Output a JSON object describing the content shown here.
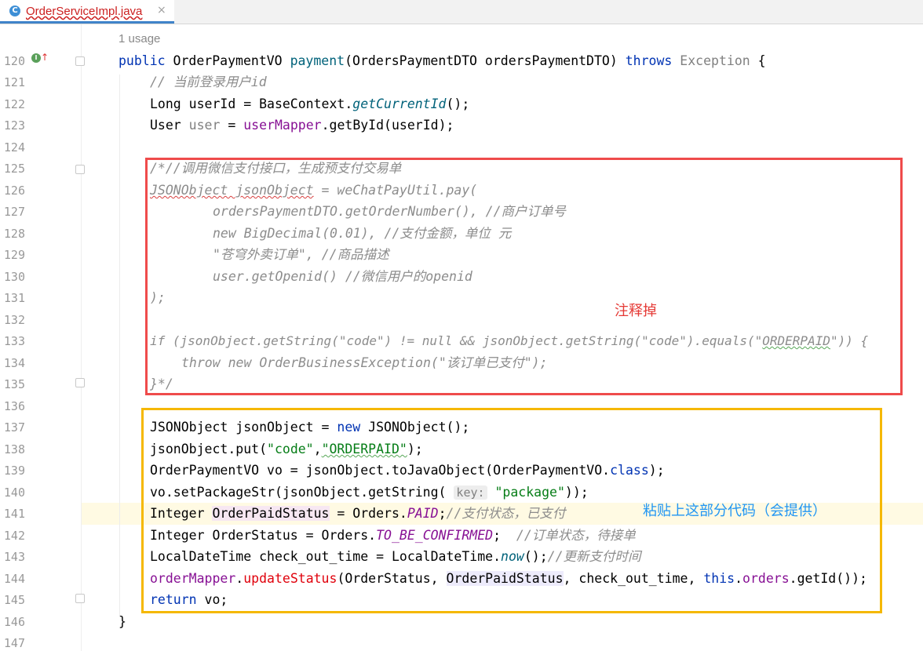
{
  "tab": {
    "icon": "C",
    "title": "OrderServiceImpl.java",
    "close": "×"
  },
  "usage": "1 usage",
  "line_numbers": [
    "120",
    "121",
    "122",
    "123",
    "124",
    "125",
    "126",
    "127",
    "128",
    "129",
    "130",
    "131",
    "132",
    "133",
    "134",
    "135",
    "136",
    "137",
    "138",
    "139",
    "140",
    "141",
    "142",
    "143",
    "144",
    "145",
    "146",
    "147"
  ],
  "code": {
    "l120": {
      "a": "public ",
      "b": "OrderPaymentVO ",
      "c": "payment",
      "d": "(OrdersPaymentDTO ordersPaymentDTO) ",
      "e": "throws ",
      "f": "Exception",
      "g": " {"
    },
    "l121": "// 当前登录用户id",
    "l122": {
      "a": "Long userId = BaseContext.",
      "b": "getCurrentId",
      "c": "();"
    },
    "l123": {
      "a": "User ",
      "b": "user",
      "c": " = ",
      "d": "userMapper",
      "e": ".getById(userId);"
    },
    "l125": {
      "a": "/*",
      "b": "//调用微信支付接口，生成预支付交易单"
    },
    "l126": {
      "a": "JSONObject jsonObject",
      "b": " = weChatPayUtil.pay("
    },
    "l127": "ordersPaymentDTO.getOrderNumber(), //商户订单号",
    "l128": "new BigDecimal(0.01), //支付金额，单位 元",
    "l129": "\"苍穹外卖订单\", //商品描述",
    "l130": "user.getOpenid() //微信用户的openid",
    "l131": ");",
    "l133": {
      "a": "if (jsonObject.getString(\"code\") != null && jsonObject.getString(\"code\").equals(\"",
      "b": "ORDERPAID",
      "c": "\")) {"
    },
    "l134": "throw new OrderBusinessException(\"该订单已支付\");",
    "l135": "}*/",
    "l137": {
      "a": "JSONObject jsonObject = ",
      "b": "new ",
      "c": "JSONObject();"
    },
    "l138": {
      "a": "jsonObject.put(",
      "b": "\"code\"",
      "c": ",",
      "d": "\"ORDERPAID\"",
      "e": ");"
    },
    "l139": {
      "a": "OrderPaymentVO vo = jsonObject.toJavaObject(OrderPaymentVO.",
      "b": "class",
      "c": ");"
    },
    "l140": {
      "a": "vo.setPackageStr(jsonObject.getString( ",
      "hint": "key:",
      "b": " \"package\"",
      "c": "));"
    },
    "l141": {
      "a": "Integer ",
      "b": "OrderPaidStatus",
      "c": " = Orders.",
      "d": "PAID",
      "e": ";",
      "f": "//支付状态，已支付"
    },
    "l142": {
      "a": "Integer OrderStatus = Orders.",
      "b": "TO_BE_CONFIRMED",
      "c": ";  ",
      "d": "//订单状态，待接单"
    },
    "l143": {
      "a": "LocalDateTime check_out_time = LocalDateTime.",
      "b": "now",
      "c": "();",
      "d": "//更新支付时间"
    },
    "l144": {
      "a": "orderMapper",
      "b": ".",
      "c": "updateStatus",
      "d": "(OrderStatus, ",
      "e": "OrderPaidStatus",
      "f": ", check_out_time, ",
      "g": "this",
      "h": ".",
      "i": "orders",
      "j": ".getId());"
    },
    "l145": {
      "a": "return ",
      "b": "vo;"
    },
    "l146": "}"
  },
  "annotations": {
    "red_note": "注释掉",
    "blue_note": "粘贴上这部分代码（会提供）"
  },
  "colors": {
    "red_box": "#ef4b4b",
    "yellow_box": "#f5b800",
    "tab_underline": "#4083c9"
  }
}
